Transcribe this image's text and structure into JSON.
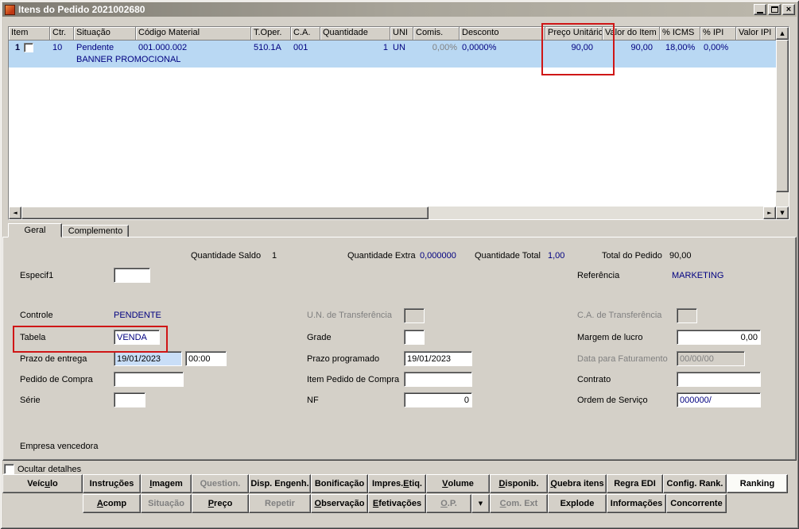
{
  "window": {
    "title": "Itens do Pedido 2021002680"
  },
  "icons": {
    "up_arrow": "▲",
    "down_arrow": "▼",
    "left_arrow": "◄",
    "right_arrow": "►",
    "dropdown_arrow": "▼",
    "close": "×"
  },
  "colors": {
    "highlight_box": "#cf1616",
    "selected_row_bg": "#b9d8f3",
    "value_text": "#000080",
    "face": "#d4d0c8"
  },
  "grid": {
    "columns": [
      {
        "label": "Item"
      },
      {
        "label": "Ctr."
      },
      {
        "label": "Situação"
      },
      {
        "label": "Código Material"
      },
      {
        "label": "T.Oper."
      },
      {
        "label": "C.A."
      },
      {
        "label": "Quantidade"
      },
      {
        "label": "UNI"
      },
      {
        "label": "Comis."
      },
      {
        "label": "Desconto"
      },
      {
        "label": "Preço Unitário"
      },
      {
        "label": "Valor do Item"
      },
      {
        "label": "% ICMS"
      },
      {
        "label": "% IPI"
      },
      {
        "label": "Valor IPI"
      }
    ],
    "row": {
      "item": "1",
      "ctr": "10",
      "situacao": "Pendente",
      "codigo_material": "001.000.002",
      "t_oper": "510.1A",
      "ca": "001",
      "quantidade": "1",
      "uni": "UN",
      "comis": "0,00%",
      "desconto": "0,0000%",
      "preco_unitario": "90,00",
      "valor_item": "90,00",
      "icms": "18,00%",
      "ipi": "0,00%",
      "valor_ipi": "",
      "descricao": "BANNER PROMOCIONAL",
      "checked": false
    }
  },
  "tabs": [
    {
      "label": "Geral",
      "selected": true
    },
    {
      "label": "Complemento",
      "selected": false
    }
  ],
  "summary": {
    "quantidade_saldo": {
      "label": "Quantidade Saldo",
      "value": "1"
    },
    "quantidade_extra": {
      "label": "Quantidade Extra",
      "value": "0,000000"
    },
    "quantidade_total": {
      "label": "Quantidade Total",
      "value": "1,00"
    },
    "total_pedido": {
      "label": "Total do Pedido",
      "value": "90,00"
    }
  },
  "form": {
    "especif1": {
      "label": "Especif1",
      "value": ""
    },
    "referencia": {
      "label": "Referência",
      "value": "MARKETING"
    },
    "controle": {
      "label": "Controle",
      "value": "PENDENTE"
    },
    "un_transferencia": {
      "label": "U.N. de Transferência",
      "value": ""
    },
    "ca_transferencia": {
      "label": "C.A. de Transferência",
      "value": ""
    },
    "tabela": {
      "label": "Tabela",
      "value": "VENDA"
    },
    "grade": {
      "label": "Grade",
      "value": ""
    },
    "margem_lucro": {
      "label": "Margem de lucro",
      "value": "0,00"
    },
    "prazo_entrega": {
      "label": "Prazo de entrega",
      "date": "19/01/2023",
      "time": "00:00"
    },
    "prazo_programado": {
      "label": "Prazo programado",
      "value": "19/01/2023"
    },
    "data_faturamento": {
      "label": "Data para Faturamento",
      "value": "00/00/00"
    },
    "pedido_compra": {
      "label": "Pedido de Compra",
      "value": ""
    },
    "item_pedido_compra": {
      "label": "Item Pedido de Compra",
      "value": ""
    },
    "contrato": {
      "label": "Contrato",
      "value": ""
    },
    "serie": {
      "label": "Série",
      "value": ""
    },
    "nf": {
      "label": "NF",
      "value": "0"
    },
    "ordem_servico": {
      "label": "Ordem de Serviço",
      "value": "000000/"
    },
    "empresa_vencedora": {
      "label": "Empresa vencedora"
    }
  },
  "footer": {
    "ocultar_detalhes": "Ocultar detalhes"
  },
  "buttons": {
    "row1": [
      {
        "label": "Veículo",
        "ul": 4
      },
      {
        "label": "Instruções",
        "ul": 6
      },
      {
        "label": "Imagem",
        "ul": 0
      },
      {
        "label": "Question.",
        "disabled": true
      },
      {
        "label": "Disp. Engenh."
      },
      {
        "label": "Bonificação"
      },
      {
        "label": "Impres. Etiq.",
        "ul": 8
      },
      {
        "label": "Volume",
        "ul": 0
      },
      {
        "label": "Disponib.",
        "ul": 0
      },
      {
        "label": "Quebra itens",
        "ul": 0
      },
      {
        "label": "Regra EDI"
      },
      {
        "label": "Config. Rank."
      },
      {
        "label": "Ranking",
        "active": true
      }
    ],
    "row2": [
      {
        "label": "Acomp",
        "ul": 0
      },
      {
        "label": "Situação",
        "disabled": true
      },
      {
        "label": "Preço",
        "ul": 0
      },
      {
        "label": "Repetir",
        "disabled": true
      },
      {
        "label": "Observação",
        "ul": 0
      },
      {
        "label": "Efetivações",
        "ul": 0
      },
      {
        "label": "O.P.",
        "ul": 0,
        "disabled": true
      },
      {
        "label": "Com. Ext",
        "ul": 0,
        "disabled": true
      },
      {
        "label": "Explode"
      },
      {
        "label": "Informações"
      },
      {
        "label": "Concorrente"
      }
    ]
  }
}
